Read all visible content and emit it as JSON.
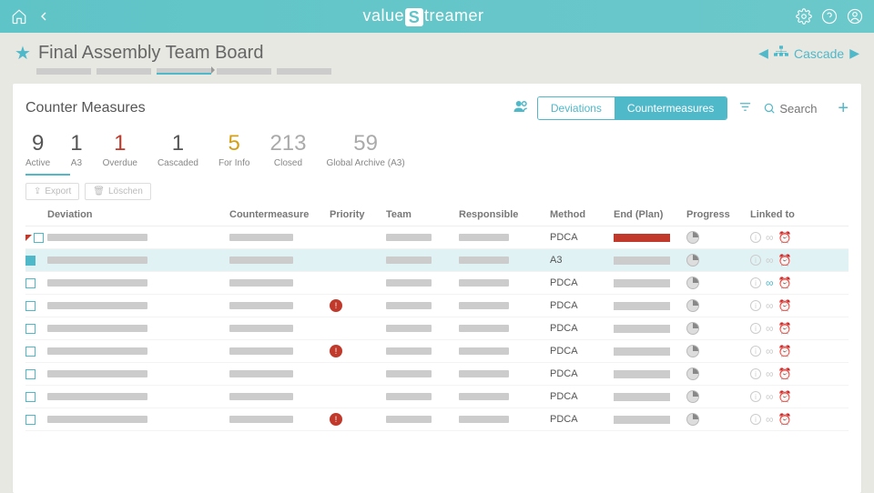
{
  "topbar": {
    "logo": "valueStreamer"
  },
  "header": {
    "title": "Final Assembly Team Board",
    "cascade": "Cascade"
  },
  "panel": {
    "title": "Counter Measures"
  },
  "toggle": {
    "left": "Deviations",
    "right": "Countermeasures"
  },
  "search": {
    "placeholder": "Search"
  },
  "stats": [
    {
      "num": "9",
      "lbl": "Active",
      "cls": "active-stat"
    },
    {
      "num": "1",
      "lbl": "A3",
      "cls": ""
    },
    {
      "num": "1",
      "lbl": "Overdue",
      "cls": "overdue"
    },
    {
      "num": "1",
      "lbl": "Cascaded",
      "cls": ""
    },
    {
      "num": "5",
      "lbl": "For Info",
      "cls": "forinfo"
    },
    {
      "num": "213",
      "lbl": "Closed",
      "cls": "muted"
    },
    {
      "num": "59",
      "lbl": "Global Archive (A3)",
      "cls": "muted"
    }
  ],
  "actions": {
    "export": "Export",
    "delete": "Löschen"
  },
  "columns": [
    "Deviation",
    "Countermeasure",
    "Priority",
    "Team",
    "Responsible",
    "Method",
    "End (Plan)",
    "Progress",
    "Linked to"
  ],
  "rows": [
    {
      "method": "PDCA",
      "corner": true,
      "priority": false,
      "endred": true,
      "highlight": false,
      "alarm": true,
      "link": false
    },
    {
      "method": "A3",
      "corner": false,
      "priority": false,
      "endred": false,
      "highlight": true,
      "alarm": false,
      "link": false
    },
    {
      "method": "PDCA",
      "corner": false,
      "priority": false,
      "endred": false,
      "highlight": false,
      "alarm": false,
      "link": true
    },
    {
      "method": "PDCA",
      "corner": false,
      "priority": true,
      "endred": false,
      "highlight": false,
      "alarm": true,
      "link": false
    },
    {
      "method": "PDCA",
      "corner": false,
      "priority": false,
      "endred": false,
      "highlight": false,
      "alarm": false,
      "link": false
    },
    {
      "method": "PDCA",
      "corner": false,
      "priority": true,
      "endred": false,
      "highlight": false,
      "alarm": false,
      "link": false
    },
    {
      "method": "PDCA",
      "corner": false,
      "priority": false,
      "endred": false,
      "highlight": false,
      "alarm": false,
      "link": false
    },
    {
      "method": "PDCA",
      "corner": false,
      "priority": false,
      "endred": false,
      "highlight": false,
      "alarm": false,
      "link": false
    },
    {
      "method": "PDCA",
      "corner": false,
      "priority": true,
      "endred": false,
      "highlight": false,
      "alarm": false,
      "link": false
    }
  ]
}
